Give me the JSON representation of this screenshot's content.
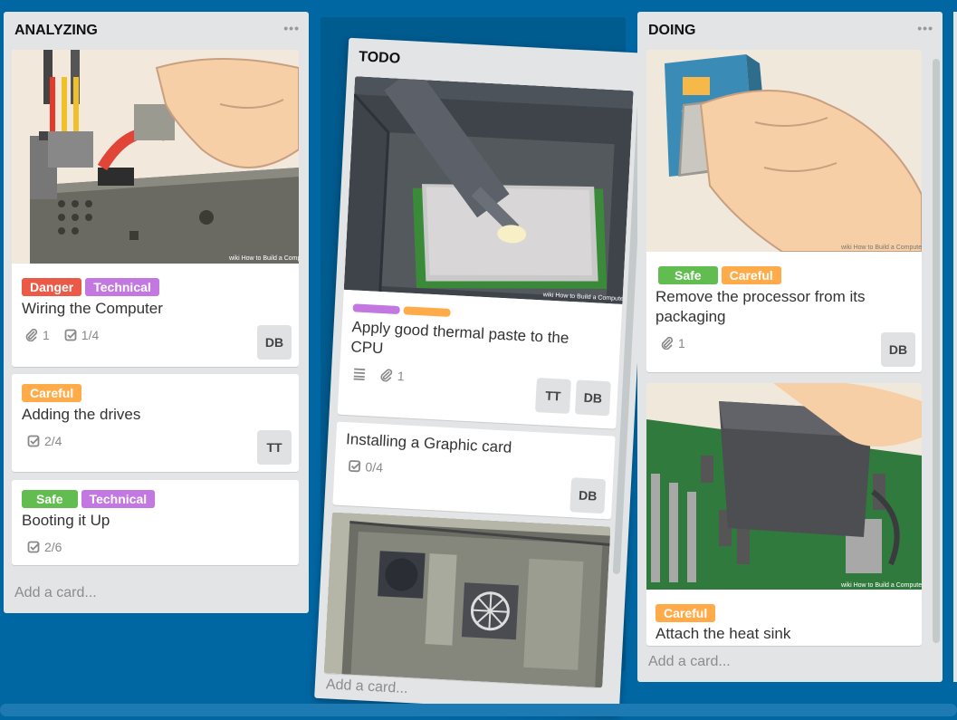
{
  "colors": {
    "board_bg": "#0067a3",
    "danger": "#eb5a46",
    "technical": "#c377e0",
    "careful": "#ffab4a",
    "safe": "#61bd4f"
  },
  "lists": {
    "analyzing": {
      "title": "ANALYZING",
      "menu": "•••",
      "add_card": "Add a card...",
      "cards": [
        {
          "labels": [
            "Danger",
            "Technical"
          ],
          "title": "Wiring the Computer",
          "attachments": "1",
          "checklist": "1/4",
          "member": "DB",
          "cover_icon": "gpu-power-cable-illustration"
        },
        {
          "labels": [
            "Careful"
          ],
          "title": "Adding the drives",
          "checklist": "2/4",
          "member": "TT"
        },
        {
          "labels": [
            "Safe",
            "Technical"
          ],
          "title": "Booting it Up",
          "checklist": "2/6"
        }
      ]
    },
    "todo": {
      "title": "TODO",
      "add_card": "Add a card...",
      "cards": [
        {
          "title": "Apply good thermal paste to the CPU",
          "attachments": "1",
          "members": [
            "TT",
            "DB"
          ],
          "cover_icon": "thermal-paste-illustration"
        },
        {
          "title": "Installing a Graphic card",
          "checklist": "0/4",
          "member": "DB"
        },
        {
          "cover_icon": "computer-case-illustration"
        }
      ]
    },
    "doing": {
      "title": "DOING",
      "menu": "•••",
      "add_card": "Add a card...",
      "cards": [
        {
          "labels": [
            "Safe",
            "Careful"
          ],
          "title": "Remove the processor from its packaging",
          "attachments": "1",
          "member": "DB",
          "cover_icon": "cpu-packaging-illustration"
        },
        {
          "labels": [
            "Careful"
          ],
          "title": "Attach the heat sink",
          "cover_icon": "heat-sink-illustration"
        }
      ]
    }
  },
  "watermark": "wiki How to Build a Computer"
}
